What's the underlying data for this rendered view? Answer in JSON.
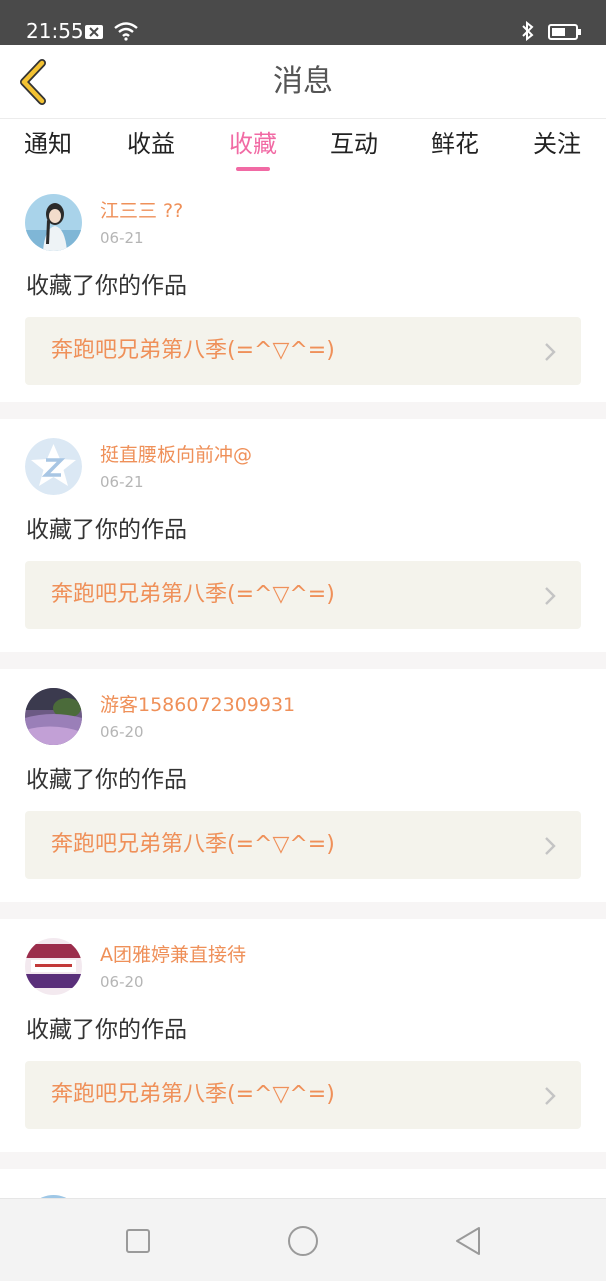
{
  "status_bar": {
    "time": "21:55",
    "icons": [
      "close-box-icon",
      "wifi-icon",
      "bluetooth-icon",
      "battery-icon"
    ]
  },
  "header": {
    "title": "消息",
    "back_icon": "chevron-left-icon",
    "back_color": "#f3c232"
  },
  "tabs": [
    {
      "label": "通知"
    },
    {
      "label": "收益"
    },
    {
      "label": "收藏"
    },
    {
      "label": "互动"
    },
    {
      "label": "鲜花"
    },
    {
      "label": "关注"
    }
  ],
  "active_tab": "收藏",
  "colors": {
    "accent": "#f16aa4",
    "username": "#ef9059",
    "work_title": "#ef9059",
    "work_bg": "#f4f3ec"
  },
  "messages": [
    {
      "user": "江三三 ??",
      "date": "06-21",
      "text": "收藏了你的作品",
      "work": "奔跑吧兄弟第八季(=^▽^=)",
      "avatar": "girl-portrait-avatar"
    },
    {
      "user": "挺直腰板向前冲@",
      "date": "06-21",
      "text": "收藏了你的作品",
      "work": "奔跑吧兄弟第八季(=^▽^=)",
      "avatar": "default-z-avatar"
    },
    {
      "user": "游客1586072309931",
      "date": "06-20",
      "text": "收藏了你的作品",
      "work": "奔跑吧兄弟第八季(=^▽^=)",
      "avatar": "landscape-avatar"
    },
    {
      "user": "A团雅婷兼直接待",
      "date": "06-20",
      "text": "收藏了你的作品",
      "work": "奔跑吧兄弟第八季(=^▽^=)",
      "avatar": "recruit-banner-avatar"
    }
  ],
  "system_nav": [
    "recents-square-icon",
    "home-circle-icon",
    "back-triangle-icon"
  ]
}
